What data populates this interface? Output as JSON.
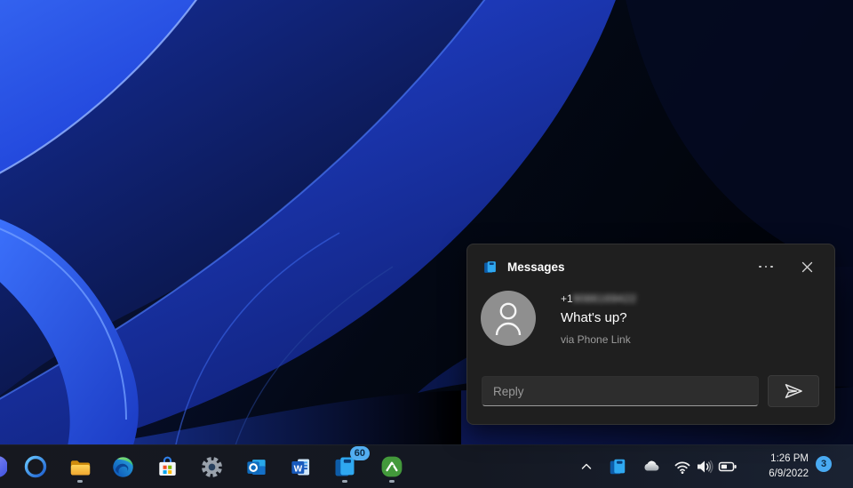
{
  "toast": {
    "title": "Messages",
    "sender_prefix": "+1",
    "sender_masked": "9086169422",
    "message": "What's up?",
    "via": "via Phone Link",
    "reply_placeholder": "Reply"
  },
  "taskbar": {
    "apps": [
      "cortana",
      "file-explorer",
      "edge",
      "microsoft-store",
      "settings",
      "outlook",
      "word",
      "phone-link",
      "alltrails"
    ],
    "running_apps": [
      "file-explorer",
      "phone-link",
      "alltrails"
    ],
    "phone_link_badge": "60",
    "word_glyph": "W",
    "tray": {
      "time": "1:26 PM",
      "date": "6/9/2022",
      "notification_count": "3"
    }
  },
  "colors": {
    "toast_bg": "#1f1f1f",
    "input_bg": "#2d2d2d",
    "avatar_gray": "#8f8f8f",
    "badge_blue": "#53aef0",
    "taskbar_dark": "#16181f",
    "wallpaper_bright_blue": "#2f5fe8",
    "wallpaper_deep_blue": "#0d1a66"
  }
}
